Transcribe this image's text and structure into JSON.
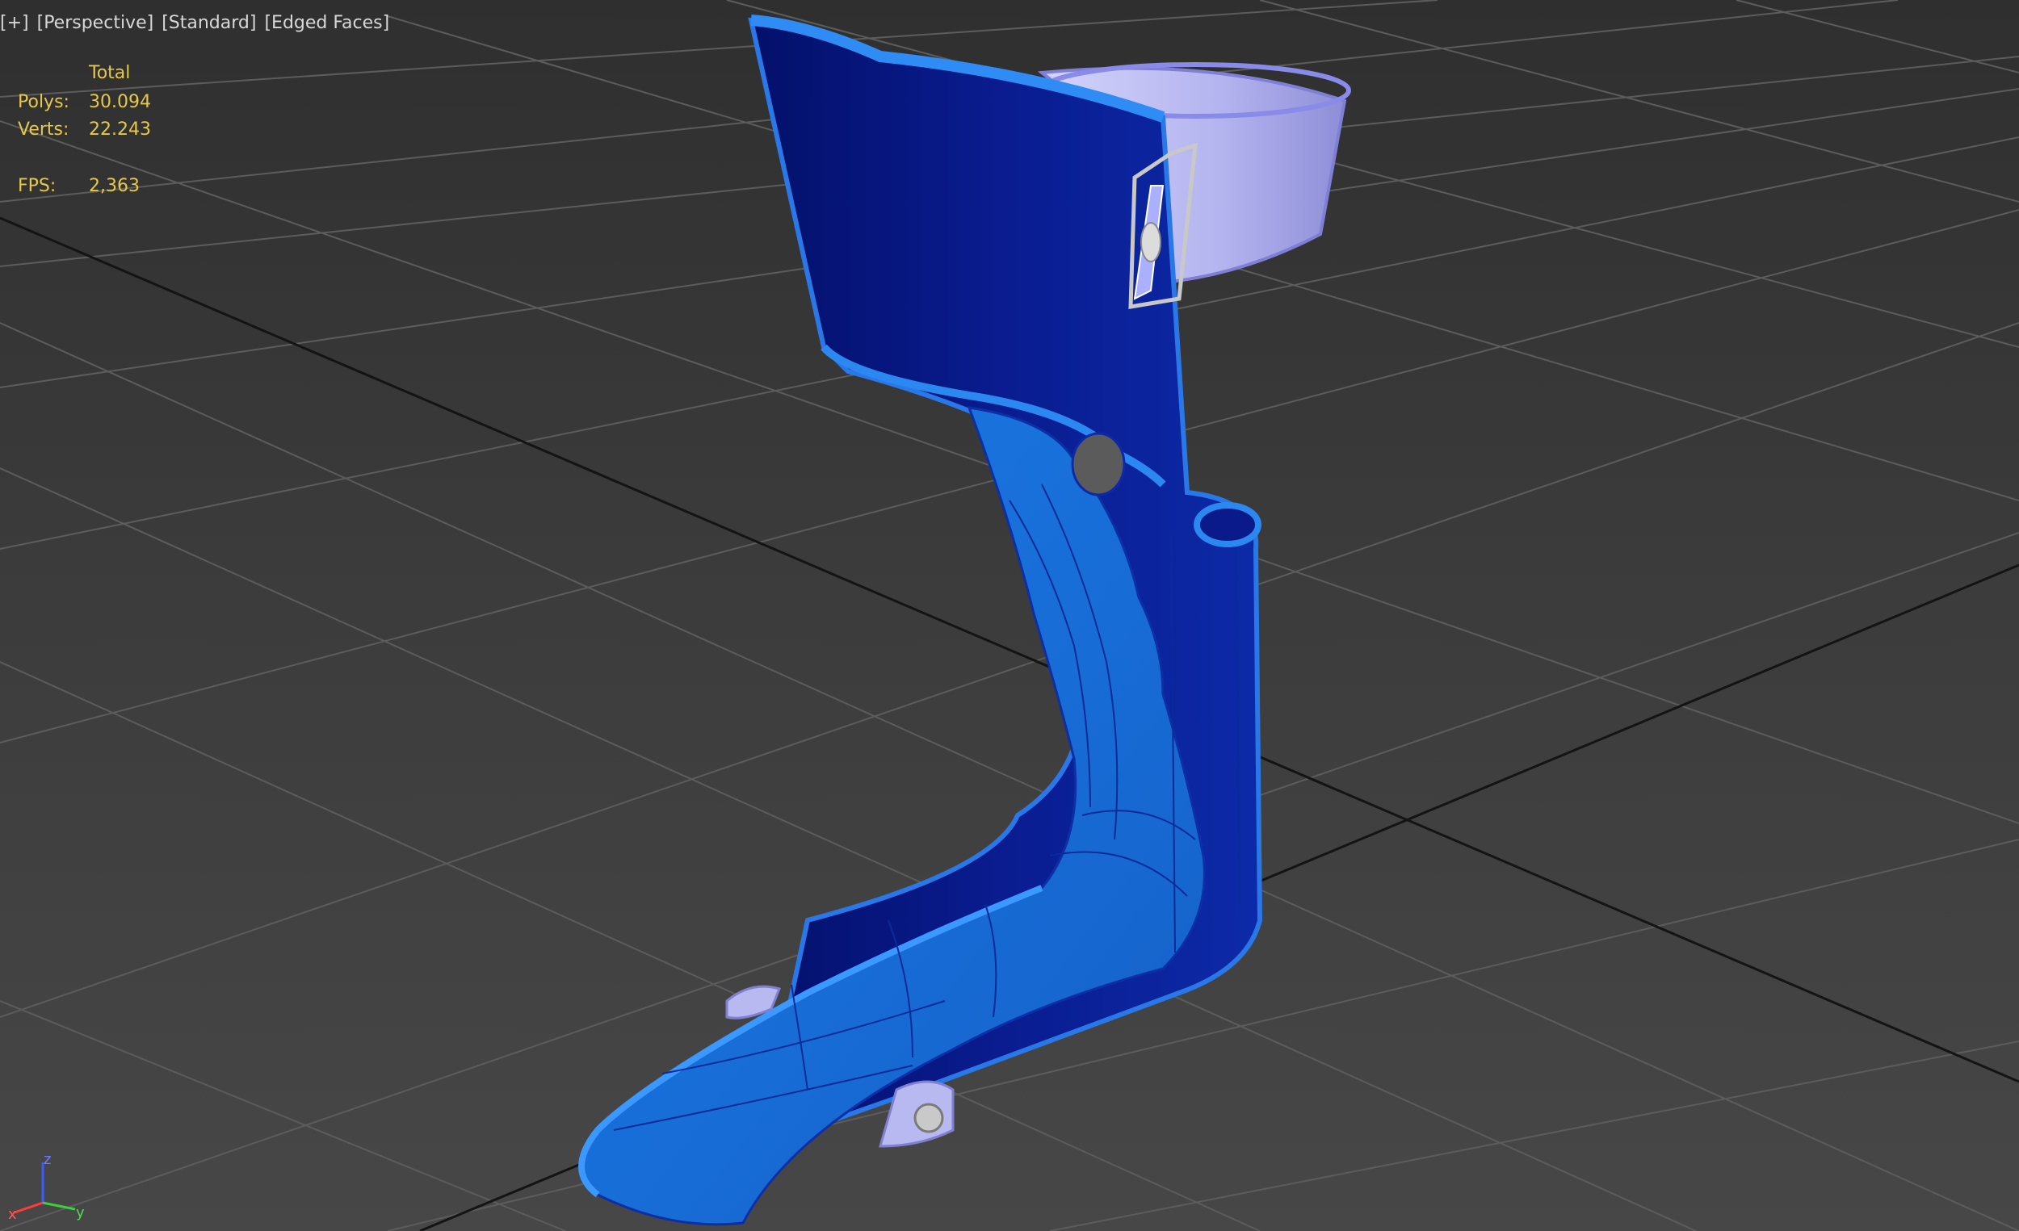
{
  "viewport": {
    "labels": [
      "[+]",
      "[Perspective]",
      "[Standard]",
      "[Edged Faces]"
    ]
  },
  "stats": {
    "header": "Total",
    "polys_label": "Polys:",
    "polys_value": "30.094",
    "verts_label": "Verts:",
    "verts_value": "22.243",
    "fps_label": "FPS:",
    "fps_value": "2,363"
  },
  "axis_gizmo": {
    "z": "z",
    "x": "x",
    "y": "y"
  },
  "colors": {
    "brace_dark": "#0a1a8a",
    "brace_mid": "#1e6fd8",
    "brace_light": "#2b88f0",
    "strap": "#b8b8f4",
    "grid": "#5a5a5a",
    "grid_major": "#1a1a1a",
    "stats_text": "#e6c84a"
  },
  "icons": {
    "axis": "xyz-axis-gizmo-icon"
  }
}
